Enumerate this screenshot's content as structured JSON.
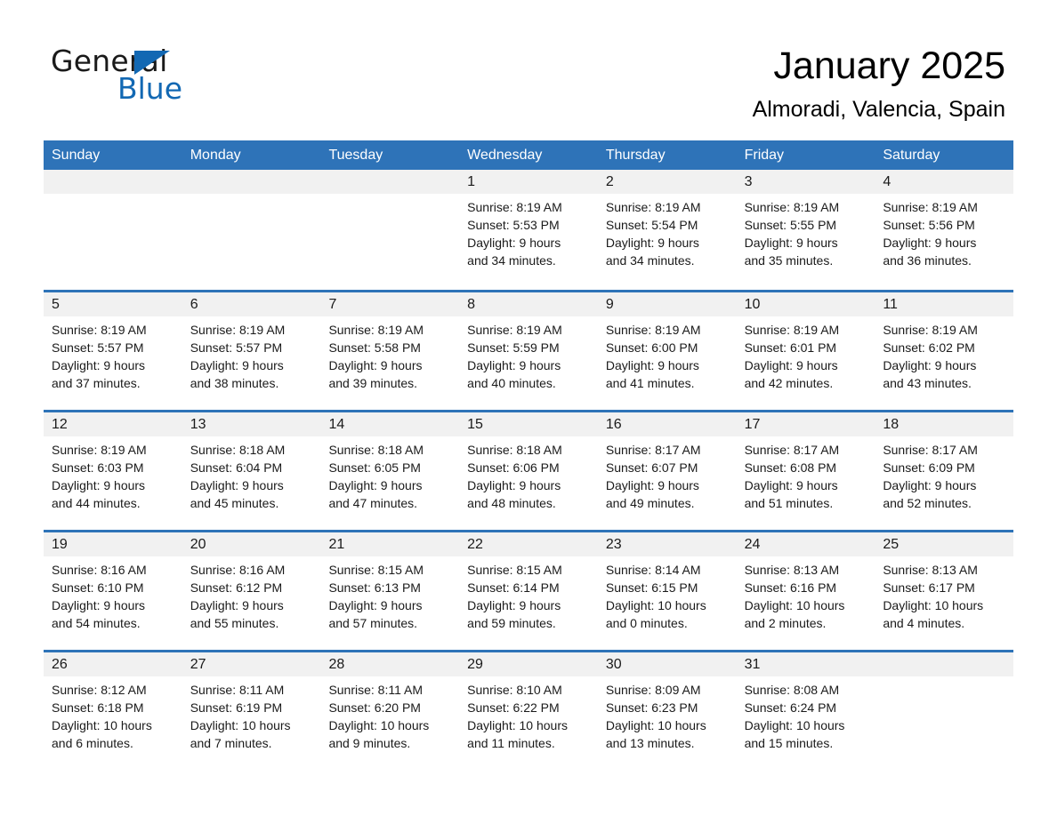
{
  "logo": {
    "line1": "General",
    "line2": "Blue",
    "triangle_icon": "blue-triangle-icon",
    "accent_color": "#1268b3"
  },
  "header": {
    "title": "January 2025",
    "location": "Almoradi, Valencia, Spain"
  },
  "colors": {
    "header_blue": "#2e73b8",
    "row_divider_blue": "#2e73b8",
    "day_band_gray": "#f1f1f1",
    "text": "#1a1a1a"
  },
  "weekdays": [
    "Sunday",
    "Monday",
    "Tuesday",
    "Wednesday",
    "Thursday",
    "Friday",
    "Saturday"
  ],
  "weeks": [
    [
      {
        "day": "",
        "empty": true
      },
      {
        "day": "",
        "empty": true
      },
      {
        "day": "",
        "empty": true
      },
      {
        "day": "1",
        "sunrise": "Sunrise: 8:19 AM",
        "sunset": "Sunset: 5:53 PM",
        "daylight_1": "Daylight: 9 hours",
        "daylight_2": "and 34 minutes."
      },
      {
        "day": "2",
        "sunrise": "Sunrise: 8:19 AM",
        "sunset": "Sunset: 5:54 PM",
        "daylight_1": "Daylight: 9 hours",
        "daylight_2": "and 34 minutes."
      },
      {
        "day": "3",
        "sunrise": "Sunrise: 8:19 AM",
        "sunset": "Sunset: 5:55 PM",
        "daylight_1": "Daylight: 9 hours",
        "daylight_2": "and 35 minutes."
      },
      {
        "day": "4",
        "sunrise": "Sunrise: 8:19 AM",
        "sunset": "Sunset: 5:56 PM",
        "daylight_1": "Daylight: 9 hours",
        "daylight_2": "and 36 minutes."
      }
    ],
    [
      {
        "day": "5",
        "sunrise": "Sunrise: 8:19 AM",
        "sunset": "Sunset: 5:57 PM",
        "daylight_1": "Daylight: 9 hours",
        "daylight_2": "and 37 minutes."
      },
      {
        "day": "6",
        "sunrise": "Sunrise: 8:19 AM",
        "sunset": "Sunset: 5:57 PM",
        "daylight_1": "Daylight: 9 hours",
        "daylight_2": "and 38 minutes."
      },
      {
        "day": "7",
        "sunrise": "Sunrise: 8:19 AM",
        "sunset": "Sunset: 5:58 PM",
        "daylight_1": "Daylight: 9 hours",
        "daylight_2": "and 39 minutes."
      },
      {
        "day": "8",
        "sunrise": "Sunrise: 8:19 AM",
        "sunset": "Sunset: 5:59 PM",
        "daylight_1": "Daylight: 9 hours",
        "daylight_2": "and 40 minutes."
      },
      {
        "day": "9",
        "sunrise": "Sunrise: 8:19 AM",
        "sunset": "Sunset: 6:00 PM",
        "daylight_1": "Daylight: 9 hours",
        "daylight_2": "and 41 minutes."
      },
      {
        "day": "10",
        "sunrise": "Sunrise: 8:19 AM",
        "sunset": "Sunset: 6:01 PM",
        "daylight_1": "Daylight: 9 hours",
        "daylight_2": "and 42 minutes."
      },
      {
        "day": "11",
        "sunrise": "Sunrise: 8:19 AM",
        "sunset": "Sunset: 6:02 PM",
        "daylight_1": "Daylight: 9 hours",
        "daylight_2": "and 43 minutes."
      }
    ],
    [
      {
        "day": "12",
        "sunrise": "Sunrise: 8:19 AM",
        "sunset": "Sunset: 6:03 PM",
        "daylight_1": "Daylight: 9 hours",
        "daylight_2": "and 44 minutes."
      },
      {
        "day": "13",
        "sunrise": "Sunrise: 8:18 AM",
        "sunset": "Sunset: 6:04 PM",
        "daylight_1": "Daylight: 9 hours",
        "daylight_2": "and 45 minutes."
      },
      {
        "day": "14",
        "sunrise": "Sunrise: 8:18 AM",
        "sunset": "Sunset: 6:05 PM",
        "daylight_1": "Daylight: 9 hours",
        "daylight_2": "and 47 minutes."
      },
      {
        "day": "15",
        "sunrise": "Sunrise: 8:18 AM",
        "sunset": "Sunset: 6:06 PM",
        "daylight_1": "Daylight: 9 hours",
        "daylight_2": "and 48 minutes."
      },
      {
        "day": "16",
        "sunrise": "Sunrise: 8:17 AM",
        "sunset": "Sunset: 6:07 PM",
        "daylight_1": "Daylight: 9 hours",
        "daylight_2": "and 49 minutes."
      },
      {
        "day": "17",
        "sunrise": "Sunrise: 8:17 AM",
        "sunset": "Sunset: 6:08 PM",
        "daylight_1": "Daylight: 9 hours",
        "daylight_2": "and 51 minutes."
      },
      {
        "day": "18",
        "sunrise": "Sunrise: 8:17 AM",
        "sunset": "Sunset: 6:09 PM",
        "daylight_1": "Daylight: 9 hours",
        "daylight_2": "and 52 minutes."
      }
    ],
    [
      {
        "day": "19",
        "sunrise": "Sunrise: 8:16 AM",
        "sunset": "Sunset: 6:10 PM",
        "daylight_1": "Daylight: 9 hours",
        "daylight_2": "and 54 minutes."
      },
      {
        "day": "20",
        "sunrise": "Sunrise: 8:16 AM",
        "sunset": "Sunset: 6:12 PM",
        "daylight_1": "Daylight: 9 hours",
        "daylight_2": "and 55 minutes."
      },
      {
        "day": "21",
        "sunrise": "Sunrise: 8:15 AM",
        "sunset": "Sunset: 6:13 PM",
        "daylight_1": "Daylight: 9 hours",
        "daylight_2": "and 57 minutes."
      },
      {
        "day": "22",
        "sunrise": "Sunrise: 8:15 AM",
        "sunset": "Sunset: 6:14 PM",
        "daylight_1": "Daylight: 9 hours",
        "daylight_2": "and 59 minutes."
      },
      {
        "day": "23",
        "sunrise": "Sunrise: 8:14 AM",
        "sunset": "Sunset: 6:15 PM",
        "daylight_1": "Daylight: 10 hours",
        "daylight_2": "and 0 minutes."
      },
      {
        "day": "24",
        "sunrise": "Sunrise: 8:13 AM",
        "sunset": "Sunset: 6:16 PM",
        "daylight_1": "Daylight: 10 hours",
        "daylight_2": "and 2 minutes."
      },
      {
        "day": "25",
        "sunrise": "Sunrise: 8:13 AM",
        "sunset": "Sunset: 6:17 PM",
        "daylight_1": "Daylight: 10 hours",
        "daylight_2": "and 4 minutes."
      }
    ],
    [
      {
        "day": "26",
        "sunrise": "Sunrise: 8:12 AM",
        "sunset": "Sunset: 6:18 PM",
        "daylight_1": "Daylight: 10 hours",
        "daylight_2": "and 6 minutes."
      },
      {
        "day": "27",
        "sunrise": "Sunrise: 8:11 AM",
        "sunset": "Sunset: 6:19 PM",
        "daylight_1": "Daylight: 10 hours",
        "daylight_2": "and 7 minutes."
      },
      {
        "day": "28",
        "sunrise": "Sunrise: 8:11 AM",
        "sunset": "Sunset: 6:20 PM",
        "daylight_1": "Daylight: 10 hours",
        "daylight_2": "and 9 minutes."
      },
      {
        "day": "29",
        "sunrise": "Sunrise: 8:10 AM",
        "sunset": "Sunset: 6:22 PM",
        "daylight_1": "Daylight: 10 hours",
        "daylight_2": "and 11 minutes."
      },
      {
        "day": "30",
        "sunrise": "Sunrise: 8:09 AM",
        "sunset": "Sunset: 6:23 PM",
        "daylight_1": "Daylight: 10 hours",
        "daylight_2": "and 13 minutes."
      },
      {
        "day": "31",
        "sunrise": "Sunrise: 8:08 AM",
        "sunset": "Sunset: 6:24 PM",
        "daylight_1": "Daylight: 10 hours",
        "daylight_2": "and 15 minutes."
      },
      {
        "day": "",
        "empty": true
      }
    ]
  ]
}
